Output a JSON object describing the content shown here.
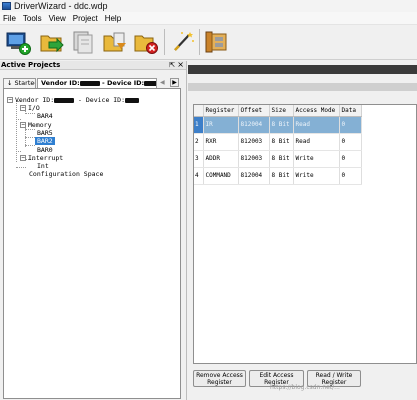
{
  "window": {
    "title": "DriverWizard - ddc.wdp"
  },
  "menu": [
    "File",
    "Tools",
    "View",
    "Project",
    "Help"
  ],
  "toolbar": {
    "buttons": [
      {
        "name": "new-project-icon"
      },
      {
        "name": "open-project-icon"
      },
      {
        "name": "save-project-icon"
      },
      {
        "name": "add-device-icon"
      },
      {
        "name": "remove-device-icon"
      },
      {
        "name": "generate-code-icon"
      },
      {
        "name": "build-icon"
      }
    ]
  },
  "left_panel": {
    "title": "Active Projects",
    "pin_glyph": "⇱",
    "close_glyph": "×",
    "tabs": {
      "started": "↓ Started",
      "device_prefix": "Vendor ID:",
      "device_mid": " - Device ID:"
    },
    "tree": {
      "root_prefix": "Vendor ID:",
      "root_mid": " - Device ID:",
      "io": "I/O",
      "bar4": "BAR4",
      "memory": "Memory",
      "bar5": "BAR5",
      "bar2": "BAR2",
      "bar0": "BAR0",
      "interrupt": "Interrupt",
      "int": "Int",
      "config": "Configuration Space"
    }
  },
  "register_table": {
    "columns": [
      "",
      "Register",
      "Offset",
      "Size",
      "Access Mode",
      "Data"
    ],
    "rows": [
      {
        "num": "1",
        "register": "IR",
        "offset": "812004",
        "size": "8 Bit",
        "mode": "Read",
        "data": "0"
      },
      {
        "num": "2",
        "register": "RXR",
        "offset": "812003",
        "size": "8 Bit",
        "mode": "Read",
        "data": "0"
      },
      {
        "num": "3",
        "register": "ADDR",
        "offset": "812003",
        "size": "8 Bit",
        "mode": "Write",
        "data": "0"
      },
      {
        "num": "4",
        "register": "COMMAND",
        "offset": "812004",
        "size": "8 Bit",
        "mode": "Write",
        "data": "0"
      }
    ]
  },
  "buttons": {
    "remove_line1": "Remove Access",
    "remove_line2": "Register",
    "edit_line1": "Edit Access",
    "edit_line2": "Register",
    "rw_line1": "Read / Write",
    "rw_line2": "Register"
  },
  "watermark": "https://blog.csdn.net/..."
}
